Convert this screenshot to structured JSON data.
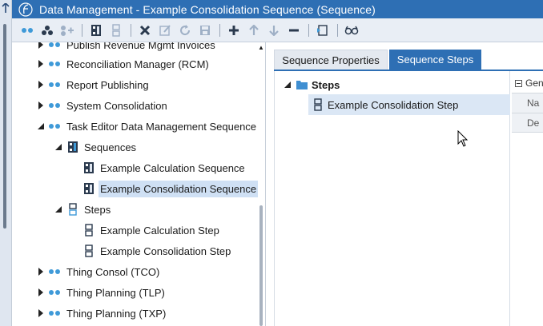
{
  "window": {
    "title": "Data Management - Example Consolidation Sequence (Sequence)"
  },
  "toolbar": {
    "buttons": [
      "Create Group",
      "Create Sequence",
      "Create Step",
      "Sequence",
      "Step",
      "Delete",
      "Rename",
      "Refresh",
      "Save",
      "Add",
      "Move Up",
      "Move Down",
      "Remove",
      "Navigate",
      "View"
    ]
  },
  "tree": {
    "items": [
      {
        "label": "Publish Revenue Mgmt Invoices",
        "type": "group"
      },
      {
        "label": "Reconciliation Manager (RCM)",
        "type": "group"
      },
      {
        "label": "Report Publishing",
        "type": "group"
      },
      {
        "label": "System Consolidation",
        "type": "group"
      },
      {
        "label": "Task Editor Data Management Sequence",
        "type": "group"
      },
      {
        "label": "Sequences",
        "type": "folder-seq"
      },
      {
        "label": "Example Calculation Sequence",
        "type": "sequence"
      },
      {
        "label": "Example Consolidation Sequence",
        "type": "sequence"
      },
      {
        "label": "Steps",
        "type": "folder-step"
      },
      {
        "label": "Example Calculation Step",
        "type": "step"
      },
      {
        "label": "Example Consolidation Step",
        "type": "step"
      },
      {
        "label": "Thing Consol (TCO)",
        "type": "group"
      },
      {
        "label": "Thing Planning (TLP)",
        "type": "group"
      },
      {
        "label": "Thing Planning (TXP)",
        "type": "group"
      }
    ]
  },
  "tabs": {
    "properties": "Sequence Properties",
    "steps": "Sequence Steps"
  },
  "steps_panel": {
    "root_label": "Steps",
    "child_label": "Example Consolidation Step"
  },
  "properties_panel": {
    "header": "Gen",
    "rows": [
      "Na",
      "De"
    ]
  },
  "colors": {
    "accent": "#2e6fb4",
    "selection": "#cfe0f4",
    "dot": "#3f9ad8"
  }
}
